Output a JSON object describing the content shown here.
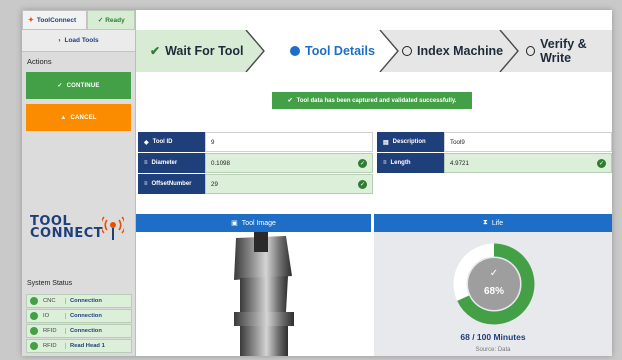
{
  "app": {
    "title": "ToolConnect",
    "status": "Ready"
  },
  "sidebar": {
    "load_tools_label": "Load Tools",
    "actions_title": "Actions",
    "continue_label": "CONTINUE",
    "cancel_label": "CANCEL",
    "logo_line1": "TOOL",
    "logo_line2": "CONNECT",
    "system_status_title": "System Status",
    "status_items": [
      {
        "key": "CNC",
        "value": "Connection"
      },
      {
        "key": "IO",
        "value": "Connection"
      },
      {
        "key": "RFID",
        "value": "Connection"
      },
      {
        "key": "RFID",
        "value": "Read Head 1"
      }
    ]
  },
  "steps": [
    {
      "label": "Wait For Tool",
      "state": "done"
    },
    {
      "label": "Tool Details",
      "state": "active"
    },
    {
      "label": "Index Machine",
      "state": "pending"
    },
    {
      "label": "Verify & Write",
      "state": "pending"
    }
  ],
  "alert": {
    "message": "Tool data has been captured and validated successfully."
  },
  "fields": {
    "tool_id_label": "Tool ID",
    "tool_id_value": "9",
    "description_label": "Description",
    "description_value": "Tool9",
    "diameter_label": "Diameter",
    "diameter_value": "0.1098",
    "length_label": "Length",
    "length_value": "4.9721",
    "offset_label": "OffsetNumber",
    "offset_value": "29"
  },
  "panels": {
    "image_title": "Tool Image",
    "life_title": "Life",
    "life_percent_label": "68%",
    "life_percent": 0.68,
    "life_text": "68 / 100 Minutes",
    "life_source": "Source: Data"
  },
  "colors": {
    "navy": "#1f3f7a",
    "blue": "#1e6ec8",
    "green": "#43a047",
    "orange": "#fb8c00"
  }
}
